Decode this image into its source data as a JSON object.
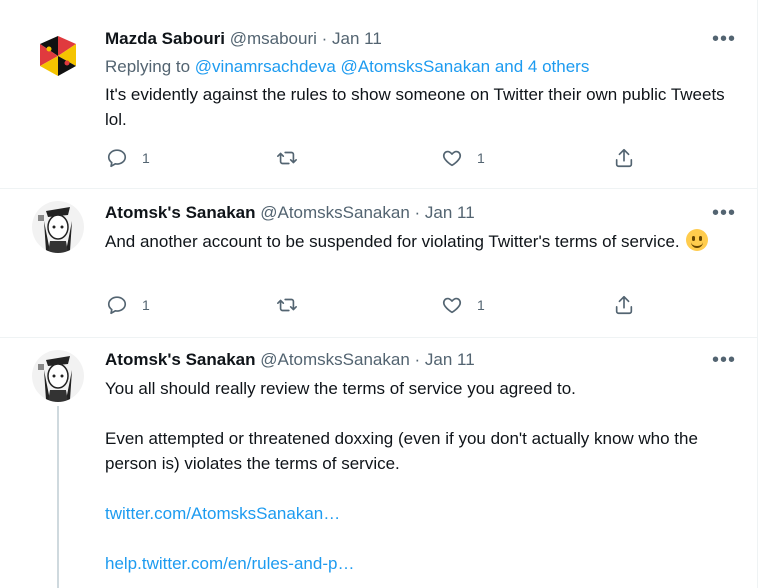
{
  "tweets": [
    {
      "name": "Mazda Sabouri",
      "handle": "@msabouri",
      "date": "· Jan 11",
      "replying_prefix": "Replying to",
      "replying_to": "@vinamrsachdeva @AtomsksSanakan and 4 others",
      "text": "It's evidently against the rules to show someone on Twitter their own public Tweets lol.",
      "reply_count": "1",
      "like_count": "1"
    },
    {
      "name": "Atomsk's Sanakan",
      "handle": "@AtomsksSanakan",
      "date": "· Jan 11",
      "text": "And another account to be suspended for violating Twitter's terms of service.",
      "emoji": "slightly-smiling-face",
      "reply_count": "1",
      "like_count": "1"
    },
    {
      "name": "Atomsk's Sanakan",
      "handle": "@AtomsksSanakan",
      "date": "· Jan 11",
      "text_line1": "You all should really review the terms of service you agreed to.",
      "text_line2": "Even attempted or threatened doxxing (even if you don't actually know who the person is) violates the terms of service.",
      "link1": "twitter.com/AtomsksSanakan…",
      "link2": "help.twitter.com/en/rules-and-p…"
    }
  ],
  "more_label": "•••",
  "colors": {
    "accent": "#1d9bf0",
    "secondary_text": "#536471",
    "divider": "#eff3f4"
  }
}
